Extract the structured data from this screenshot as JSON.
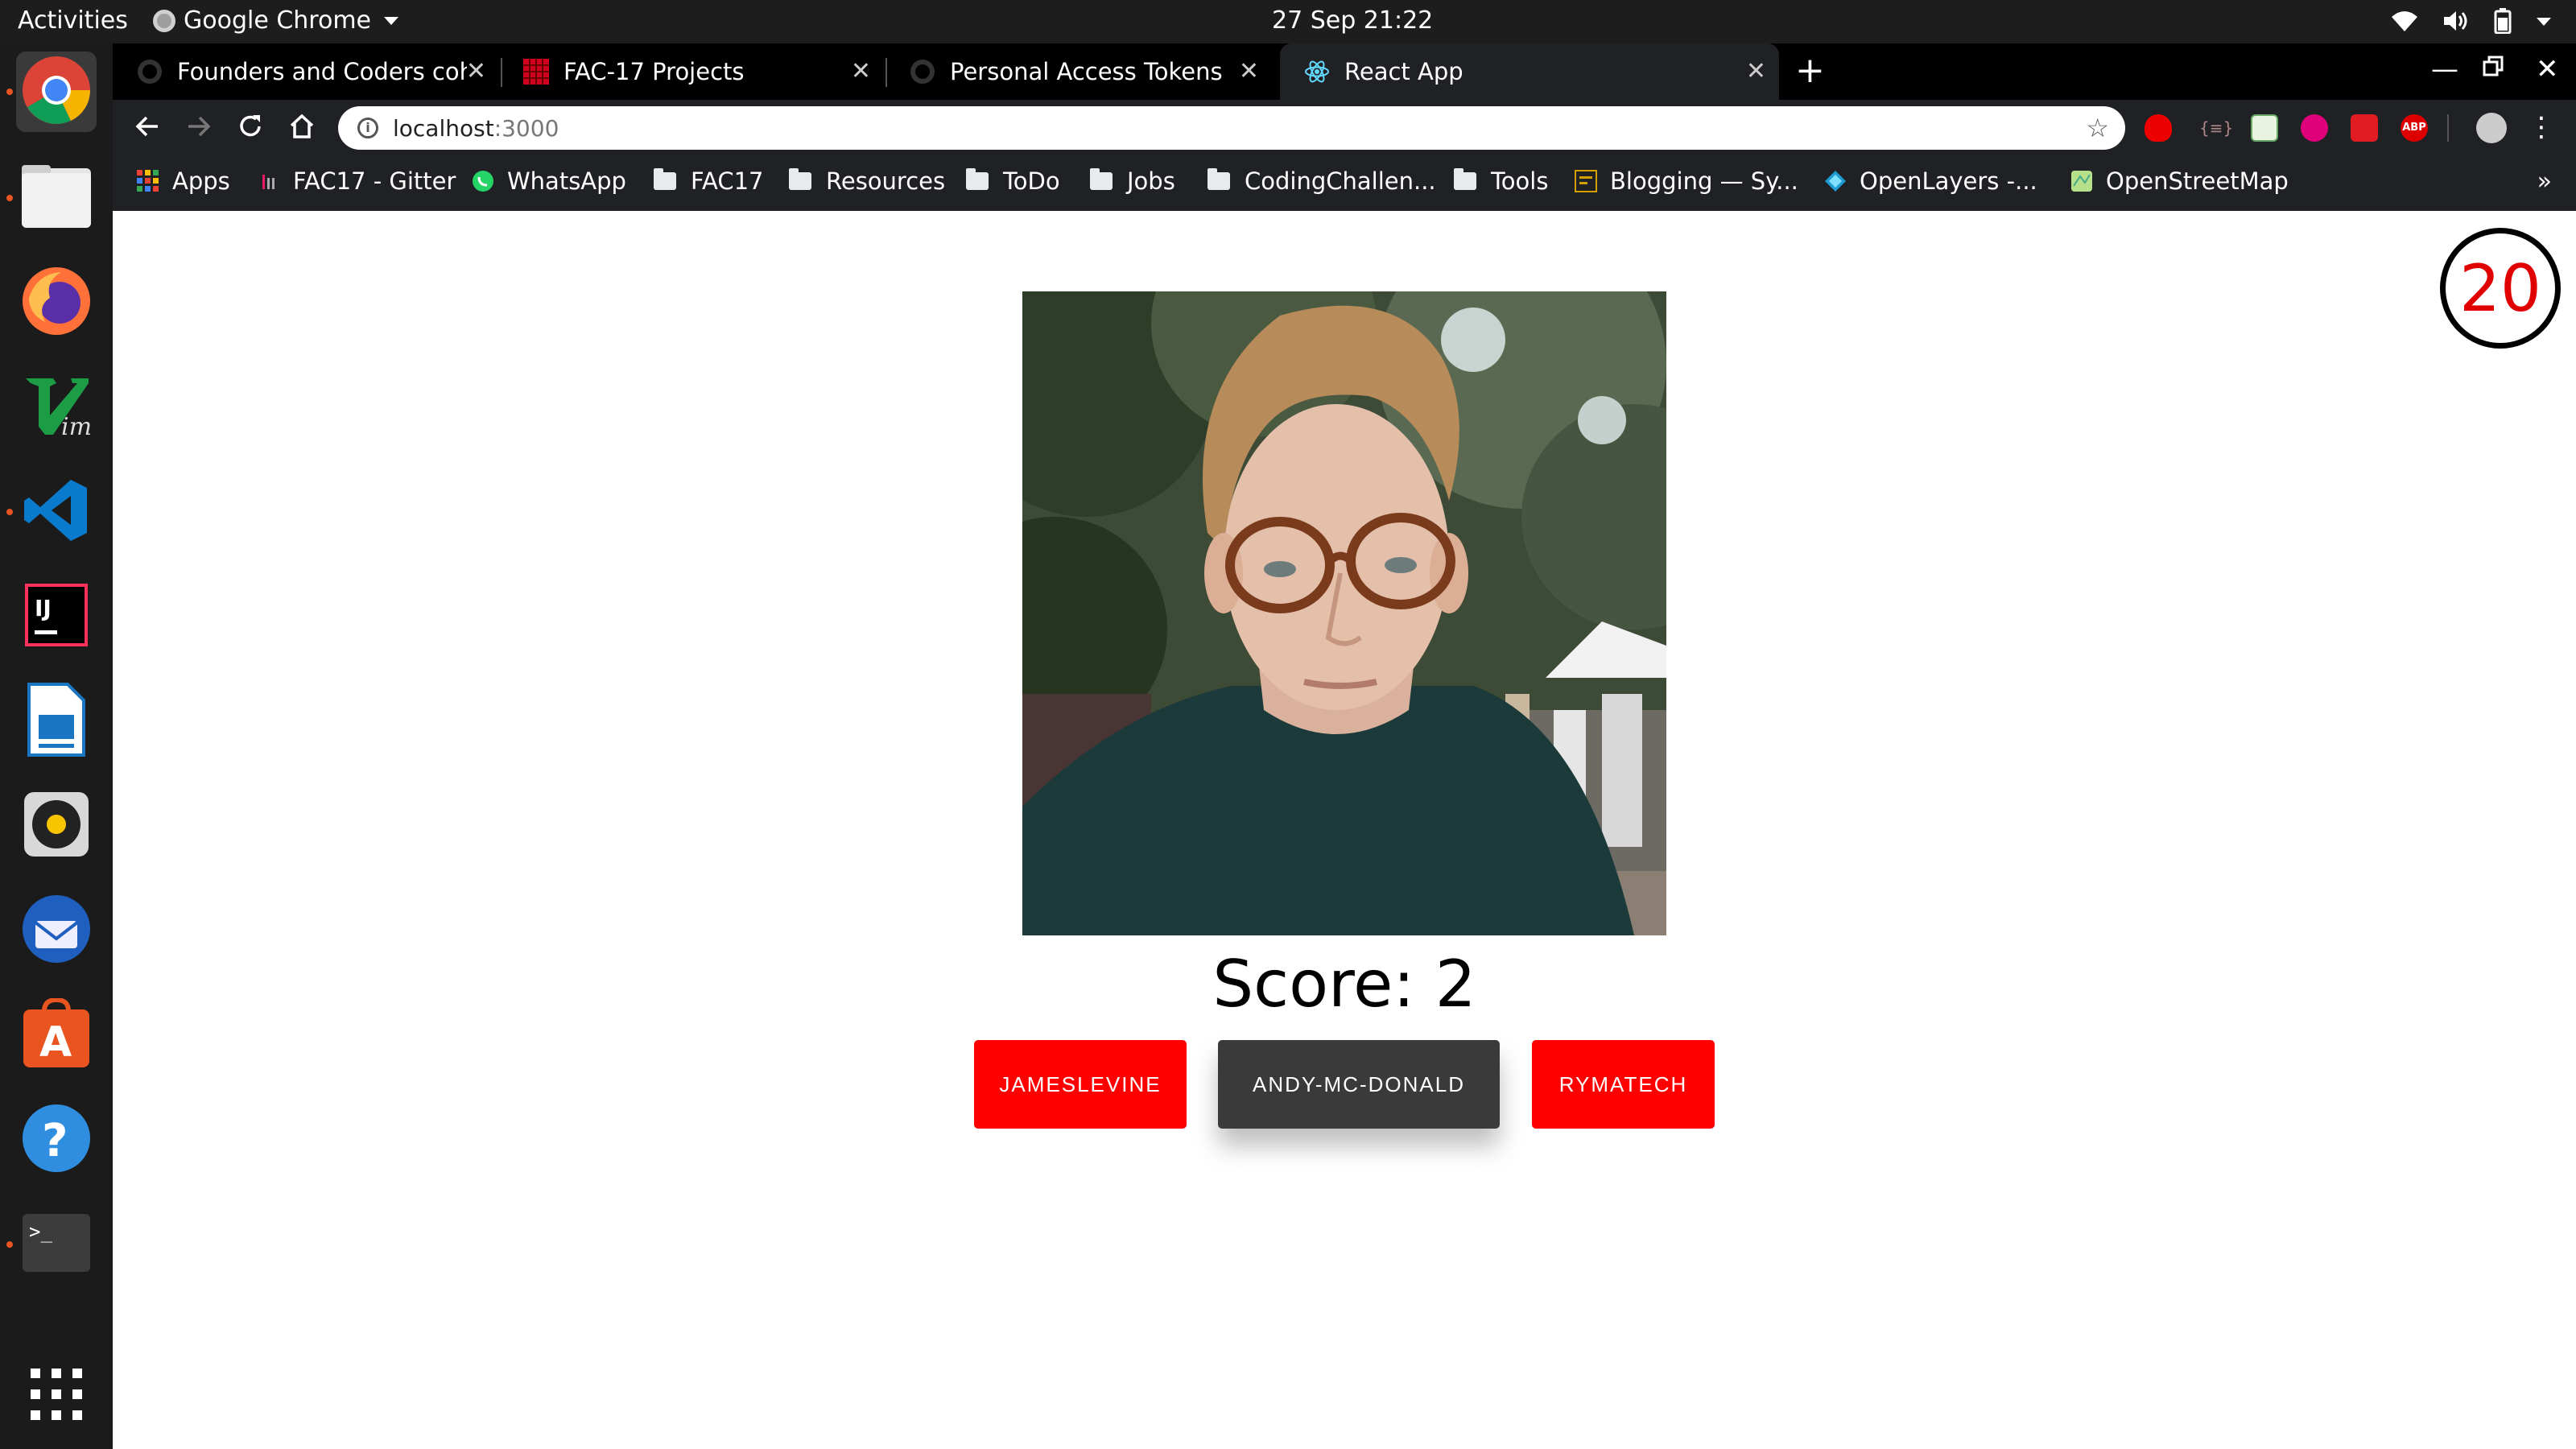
{
  "system_bar": {
    "activities": "Activities",
    "app_name": "Google Chrome",
    "datetime": "27 Sep  21:22"
  },
  "dock": {
    "items": [
      {
        "name": "chrome-icon",
        "active": true,
        "running": true
      },
      {
        "name": "files-icon",
        "active": false,
        "running": true
      },
      {
        "name": "firefox-icon",
        "active": false,
        "running": false
      },
      {
        "name": "vim-icon",
        "active": false,
        "running": false
      },
      {
        "name": "vscode-icon",
        "active": false,
        "running": true
      },
      {
        "name": "intellij-icon",
        "active": false,
        "running": false
      },
      {
        "name": "libreoffice-writer-icon",
        "active": false,
        "running": false
      },
      {
        "name": "rhythmbox-icon",
        "active": false,
        "running": false
      },
      {
        "name": "thunderbird-icon",
        "active": false,
        "running": false
      },
      {
        "name": "software-center-icon",
        "active": false,
        "running": false
      },
      {
        "name": "help-icon",
        "active": false,
        "running": false
      },
      {
        "name": "terminal-icon",
        "active": false,
        "running": true
      }
    ]
  },
  "tabs": [
    {
      "title": "Founders and Coders coh",
      "active": false
    },
    {
      "title": "FAC-17 Projects",
      "active": false
    },
    {
      "title": "Personal Access Tokens",
      "active": false
    },
    {
      "title": "React App",
      "active": true
    }
  ],
  "address_bar": {
    "host": "localhost",
    "port": ":3000"
  },
  "bookmarks": [
    {
      "label": "Apps",
      "type": "apps"
    },
    {
      "label": "FAC17 - Gitter",
      "type": "site"
    },
    {
      "label": "WhatsApp",
      "type": "site"
    },
    {
      "label": "FAC17",
      "type": "folder"
    },
    {
      "label": "Resources",
      "type": "folder"
    },
    {
      "label": "ToDo",
      "type": "folder"
    },
    {
      "label": "Jobs",
      "type": "folder"
    },
    {
      "label": "CodingChallen...",
      "type": "folder"
    },
    {
      "label": "Tools",
      "type": "folder"
    },
    {
      "label": "Blogging — Sy...",
      "type": "site"
    },
    {
      "label": "OpenLayers -...",
      "type": "site"
    },
    {
      "label": "OpenStreetMap",
      "type": "site"
    }
  ],
  "bookmarks_more": "»",
  "game": {
    "score_label": "Score: 2",
    "timer": "20",
    "choices": [
      {
        "label": "JAMESLEVINE",
        "style": "red"
      },
      {
        "label": "ANDY-MC-DONALD",
        "style": "dark"
      },
      {
        "label": "RYMATECH",
        "style": "red"
      }
    ]
  },
  "colors": {
    "accent_red": "#ff0000",
    "dark_button": "#3a3a3a",
    "timer_text": "#e00000"
  }
}
